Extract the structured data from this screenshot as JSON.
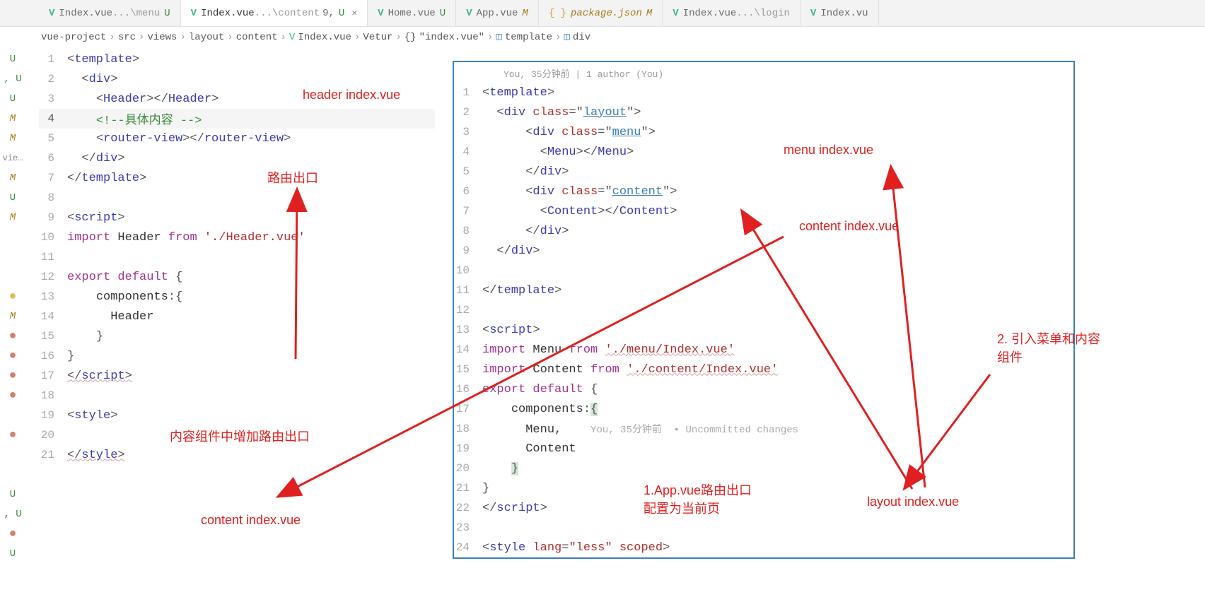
{
  "tabs": [
    {
      "icon": "vue",
      "name": "Index.vue",
      "suffix": " ...\\menu",
      "status": "U",
      "active": false
    },
    {
      "icon": "vue",
      "name": "Index.vue",
      "suffix": " ...\\content",
      "num": "9,",
      "status": "U",
      "active": true,
      "close": true
    },
    {
      "icon": "vue",
      "name": "Home.vue",
      "suffix": "",
      "status": "U",
      "active": false
    },
    {
      "icon": "vue",
      "name": "App.vue",
      "suffix": "",
      "status": "M",
      "active": false
    },
    {
      "icon": "json",
      "name": "package.json",
      "suffix": "",
      "status": "M",
      "active": false,
      "italic": true
    },
    {
      "icon": "vue",
      "name": "Index.vue",
      "suffix": " ...\\login",
      "status": "",
      "active": false
    },
    {
      "icon": "vue",
      "name": "Index.vu",
      "suffix": "",
      "status": "",
      "active": false
    }
  ],
  "breadcrumb": [
    "vue-project",
    "src",
    "views",
    "layout",
    "content",
    "Index.vue",
    "Vetur",
    "\"index.vue\"",
    "template",
    "div"
  ],
  "gutter_strip": [
    "U",
    ", U",
    "U",
    "M",
    "M",
    "vie...",
    "M",
    "U",
    "M",
    "",
    "",
    "",
    "• y",
    "M",
    "• r",
    "• r",
    "• r",
    "• r",
    "",
    "• r",
    "",
    "",
    "U",
    ", U",
    "• r",
    "U"
  ],
  "left_code": [
    {
      "n": 1,
      "html": "<span class='punc'>&lt;</span><span class='tag'>template</span><span class='punc'>&gt;</span>"
    },
    {
      "n": 2,
      "html": "  <span class='punc'>&lt;</span><span class='tag'>div</span><span class='punc'>&gt;</span>"
    },
    {
      "n": 3,
      "html": "    <span class='punc'>&lt;</span><span class='tag'>Header</span><span class='punc'>&gt;&lt;/</span><span class='tag'>Header</span><span class='punc'>&gt;</span>"
    },
    {
      "n": 4,
      "html": "    <span class='comm'>&lt;!--具体内容 --&gt;</span>",
      "active": true
    },
    {
      "n": 5,
      "html": "    <span class='punc'>&lt;</span><span class='tag'>router-view</span><span class='punc'>&gt;&lt;/</span><span class='tag'>router-view</span><span class='punc'>&gt;</span>"
    },
    {
      "n": 6,
      "html": "  <span class='punc'>&lt;/</span><span class='tag'>div</span><span class='punc'>&gt;</span>"
    },
    {
      "n": 7,
      "html": "<span class='punc'>&lt;/</span><span class='tag'>template</span><span class='punc'>&gt;</span>"
    },
    {
      "n": 8,
      "html": ""
    },
    {
      "n": 9,
      "html": "<span class='punc'>&lt;</span><span class='tag'>script</span><span class='punc'>&gt;</span>"
    },
    {
      "n": 10,
      "html": "<span class='kw2'>import</span> <span class='txt'>Header</span> <span class='kw2'>from</span> <span class='str'>'./Header.vue'</span>"
    },
    {
      "n": 11,
      "html": ""
    },
    {
      "n": 12,
      "html": "<span class='kw2'>export</span> <span class='kw2'>default</span> <span class='punc'>{</span>"
    },
    {
      "n": 13,
      "html": "    <span class='txt'>components</span><span class='punc'>:{</span>"
    },
    {
      "n": 14,
      "html": "      <span class='txt'>Header</span>"
    },
    {
      "n": 15,
      "html": "    <span class='punc'>}</span>"
    },
    {
      "n": 16,
      "html": "<span class='punc'>}</span>"
    },
    {
      "n": 17,
      "html": "<span class='punc underline'>&lt;/</span><span class='tag underline'>script</span><span class='punc underline'>&gt;</span>"
    },
    {
      "n": 18,
      "html": ""
    },
    {
      "n": 19,
      "html": "<span class='punc'>&lt;</span><span class='tag'>style</span><span class='punc'>&gt;</span>"
    },
    {
      "n": 20,
      "html": ""
    },
    {
      "n": 21,
      "html": "<span class='punc underline'>&lt;/</span><span class='tag underline'>style</span><span class='punc underline'>&gt;</span>"
    }
  ],
  "right_info": "You, 35分钟前 | 1 author (You)",
  "right_hint": "You, 35分钟前  • Uncommitted changes",
  "right_code": [
    {
      "n": 1,
      "html": "<span class='punc'>&lt;</span><span class='tag'>template</span><span class='punc'>&gt;</span>"
    },
    {
      "n": 2,
      "html": "  <span class='punc'>&lt;</span><span class='tag'>div</span> <span class='attr'>class</span><span class='punc'>=\"</span><span class='underlined-link'>layout</span><span class='punc'>\"&gt;</span>"
    },
    {
      "n": 3,
      "html": "      <span class='punc'>&lt;</span><span class='tag'>div</span> <span class='attr'>class</span><span class='punc'>=\"</span><span class='underlined-link'>menu</span><span class='punc'>\"&gt;</span>"
    },
    {
      "n": 4,
      "html": "        <span class='punc'>&lt;</span><span class='tag'>Menu</span><span class='punc'>&gt;&lt;/</span><span class='tag'>Menu</span><span class='punc'>&gt;</span>"
    },
    {
      "n": 5,
      "html": "      <span class='punc'>&lt;/</span><span class='tag'>div</span><span class='punc'>&gt;</span>"
    },
    {
      "n": 6,
      "html": "      <span class='punc'>&lt;</span><span class='tag'>div</span> <span class='attr'>class</span><span class='punc'>=\"</span><span class='underlined-link'>content</span><span class='punc'>\"&gt;</span>"
    },
    {
      "n": 7,
      "html": "        <span class='punc'>&lt;</span><span class='tag'>Content</span><span class='punc'>&gt;&lt;/</span><span class='tag'>Content</span><span class='punc'>&gt;</span>"
    },
    {
      "n": 8,
      "html": "      <span class='punc'>&lt;/</span><span class='tag'>div</span><span class='punc'>&gt;</span>"
    },
    {
      "n": 9,
      "html": "  <span class='punc'>&lt;/</span><span class='tag'>div</span><span class='punc'>&gt;</span>"
    },
    {
      "n": 10,
      "html": ""
    },
    {
      "n": 11,
      "html": "<span class='punc'>&lt;/</span><span class='tag'>template</span><span class='punc'>&gt;</span>"
    },
    {
      "n": 12,
      "html": ""
    },
    {
      "n": 13,
      "html": "<span class='punc'>&lt;</span><span class='tag'>script</span><span class='punc'>&gt;</span>"
    },
    {
      "n": 14,
      "html": "<span class='kw2'>import</span> <span class='txt'>Menu</span> <span class='kw2'>from</span> <span class='str underline'>'./menu/Index.vue'</span>"
    },
    {
      "n": 15,
      "html": "<span class='kw2'>import</span> <span class='txt'>Content</span> <span class='kw2'>from</span> <span class='str underline'>'./content/Index.vue'</span>"
    },
    {
      "n": 16,
      "html": "<span class='kw2'>export</span> <span class='kw2'>default</span> <span class='punc'>{</span>"
    },
    {
      "n": 17,
      "html": "    <span class='txt'>components</span><span class='punc'>:</span><span class='punc' style='background:#d6e6d6;'>{</span>"
    },
    {
      "n": 18,
      "html": "      <span class='txt'>Menu,</span>",
      "hint": true
    },
    {
      "n": 19,
      "html": "      <span class='txt'>Content</span>"
    },
    {
      "n": 20,
      "html": "    <span class='punc' style='background:#d6e6d6;'>}</span>"
    },
    {
      "n": 21,
      "html": "<span class='punc'>}</span>"
    },
    {
      "n": 22,
      "html": "<span class='punc'>&lt;/</span><span class='tag'>script</span><span class='punc'>&gt;</span>"
    },
    {
      "n": 23,
      "html": ""
    },
    {
      "n": 24,
      "html": "<span class='punc'>&lt;</span><span class='tag'>style</span> <span class='attr'>lang</span><span class='punc'>=</span><span class='str'>\"less\"</span> <span class='attr'>scoped</span><span class='punc'>&gt;</span>"
    }
  ],
  "annotations": {
    "header": "header index.vue",
    "router_exit": "路由出口",
    "content_add": "内容组件中增加路由出口",
    "content_idx1": "content index.vue",
    "menu_idx": "menu index.vue",
    "content_idx2": "content index.vue",
    "app_route": "1.App.vue路由出口\n配置为当前页",
    "layout_idx": "layout index.vue",
    "step2": "2. 引入菜单和内容\n组件"
  }
}
